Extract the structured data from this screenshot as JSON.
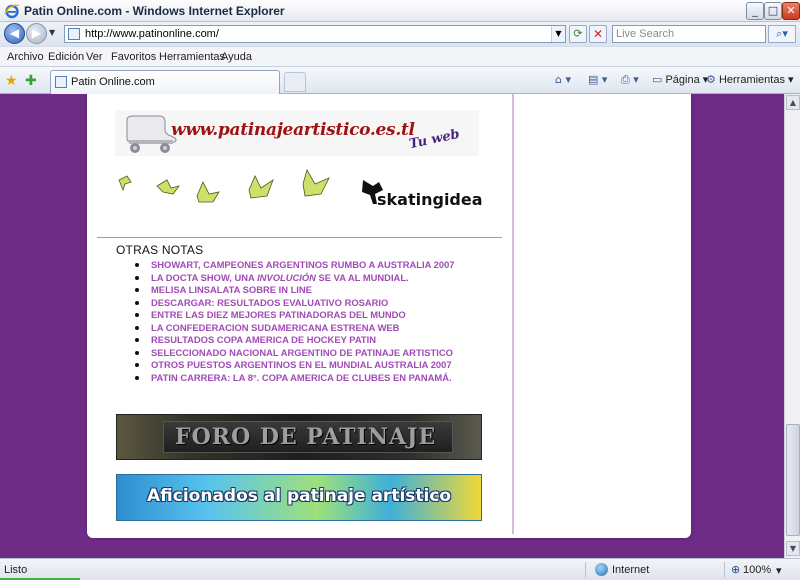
{
  "window": {
    "title": "Patin Online.com - Windows Internet Explorer",
    "min_glyph": "_",
    "max_glyph": "□",
    "close_glyph": "✕"
  },
  "addressbar": {
    "url": "http://www.patinonline.com/",
    "search_placeholder": "Live Search"
  },
  "menu": {
    "items": [
      "Archivo",
      "Edición",
      "Ver",
      "Favoritos",
      "Herramientas",
      "Ayuda"
    ]
  },
  "tabs": {
    "active_label": "Patin Online.com"
  },
  "commandbar": {
    "page_label": "Página",
    "tools_label": "Herramientas"
  },
  "page": {
    "banner_text": "www.patinajeartistico.es.tl",
    "banner_tuweb": "Tu web",
    "skatingidea": "skatingidea",
    "section_title": "OTRAS NOTAS",
    "news": [
      "SHOWART, CAMPEONES ARGENTINOS RUMBO A AUSTRALIA 2007",
      "LA DOCTA SHOW, UNA INVOLUCIÓN SE VA AL MUNDIAL.",
      "MELISA LINSALATA SOBRE IN LINE",
      "DESCARGAR: RESULTADOS EVALUATIVO ROSARIO",
      "ENTRE LAS DIEZ MEJORES PATINADORAS DEL MUNDO",
      "LA CONFEDERACION SUDAMERICANA ESTRENA WEB",
      "RESULTADOS COPA AMERICA DE HOCKEY PATIN",
      "SELECCIONADO NACIONAL ARGENTINO DE PATINAJE ARTISTICO",
      "OTROS PUESTOS ARGENTINOS EN EL MUNDIAL AUSTRALIA 2007",
      "PATIN CARRERA: LA 8°. COPA AMERICA DE CLUBES EN PANAMÁ."
    ],
    "news_2_prefix": "LA DOCTA SHOW, UNA ",
    "news_2_italic": "INVOLUCIÓN",
    "news_2_suffix": " SE VA AL MUNDIAL.",
    "foro_banner": "FORO DE PATINAJE",
    "aficionados_banner": "Aficionados al patinaje artístico"
  },
  "statusbar": {
    "status": "Listo",
    "zone": "Internet",
    "zoom": "100%"
  },
  "colors": {
    "page_background": "#6e2c87",
    "link_color": "#a14bb5",
    "banner_red": "#a01212"
  }
}
